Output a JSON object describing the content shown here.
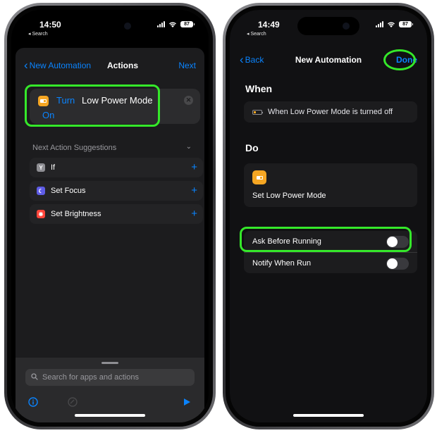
{
  "left": {
    "status": {
      "time": "14:50",
      "back_app": "◂ Search",
      "battery": "87"
    },
    "nav": {
      "back_label": "New Automation",
      "title": "Actions",
      "next_label": "Next"
    },
    "action": {
      "verb": "Turn",
      "object": "Low Power Mode",
      "state": "On"
    },
    "suggestions_header": "Next Action Suggestions",
    "suggestions": [
      {
        "label": "If",
        "icon": "if-icon",
        "color": "#8e8e93"
      },
      {
        "label": "Set Focus",
        "icon": "moon-icon",
        "color": "#5e5ce6"
      },
      {
        "label": "Set Brightness",
        "icon": "sun-icon",
        "color": "#ff453a"
      }
    ],
    "search": {
      "placeholder": "Search for apps and actions"
    }
  },
  "right": {
    "status": {
      "time": "14:49",
      "back_app": "◂ Search",
      "battery": "87"
    },
    "nav": {
      "back_label": "Back",
      "title": "New Automation",
      "done_label": "Done"
    },
    "when_header": "When",
    "trigger": "When Low Power Mode is turned off",
    "do_header": "Do",
    "do_action": "Set Low Power Mode",
    "options": [
      {
        "label": "Ask Before Running",
        "on": false
      },
      {
        "label": "Notify When Run",
        "on": false
      }
    ]
  },
  "colors": {
    "accent": "#0a84ff",
    "highlight": "#35e82a",
    "action_icon": "#f5a623"
  }
}
